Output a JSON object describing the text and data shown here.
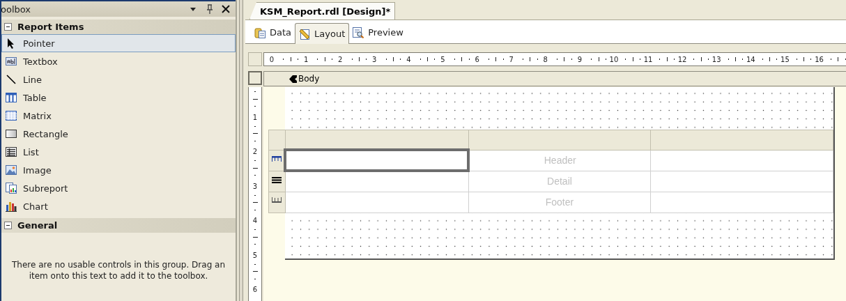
{
  "toolbox": {
    "title": "oolbox",
    "groups": [
      {
        "label": "Report Items",
        "expanded": true,
        "items": [
          {
            "label": "Pointer",
            "kind": "pointer",
            "selected": true
          },
          {
            "label": "Textbox",
            "kind": "textbox",
            "selected": false
          },
          {
            "label": "Line",
            "kind": "line",
            "selected": false
          },
          {
            "label": "Table",
            "kind": "table",
            "selected": false
          },
          {
            "label": "Matrix",
            "kind": "matrix",
            "selected": false
          },
          {
            "label": "Rectangle",
            "kind": "rectangle",
            "selected": false
          },
          {
            "label": "List",
            "kind": "list",
            "selected": false
          },
          {
            "label": "Image",
            "kind": "image",
            "selected": false
          },
          {
            "label": "Subreport",
            "kind": "subreport",
            "selected": false
          },
          {
            "label": "Chart",
            "kind": "chart",
            "selected": false
          }
        ]
      },
      {
        "label": "General",
        "expanded": true,
        "empty_text": "There are no usable controls in this group. Drag an item onto this text to add it to the toolbox."
      }
    ]
  },
  "document_tab": {
    "title": "KSM_Report.rdl [Design]*"
  },
  "view_tabs": [
    {
      "label": "Data",
      "kind": "data",
      "selected": false
    },
    {
      "label": "Layout",
      "kind": "layout",
      "selected": true
    },
    {
      "label": "Preview",
      "kind": "preview",
      "selected": false
    }
  ],
  "ruler": {
    "horizontal": [
      "0",
      "1",
      "2",
      "3",
      "4",
      "5",
      "6",
      "7",
      "8",
      "9",
      "10",
      "11",
      "12",
      "13",
      "14",
      "15",
      "16"
    ],
    "vertical": [
      "1",
      "2",
      "3",
      "4",
      "5",
      "6"
    ]
  },
  "section": {
    "label": "Body"
  },
  "table": {
    "rows": [
      {
        "kind": "header",
        "cells": [
          {
            "selected": true
          },
          {
            "text": "Header",
            "selected": false
          },
          {
            "selected": false
          }
        ]
      },
      {
        "kind": "detail",
        "cells": [
          {
            "selected": false
          },
          {
            "text": "Detail",
            "selected": false
          },
          {
            "selected": false
          }
        ]
      },
      {
        "kind": "footer",
        "cells": [
          {
            "selected": false
          },
          {
            "text": "Footer",
            "selected": false
          },
          {
            "selected": false
          }
        ]
      }
    ]
  }
}
